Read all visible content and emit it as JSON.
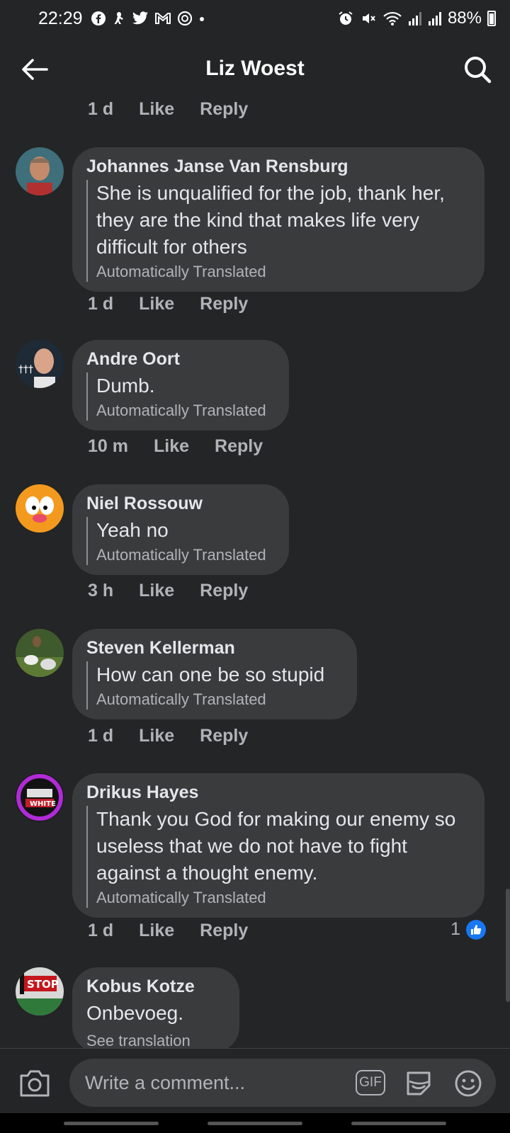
{
  "status_bar": {
    "time": "22:29",
    "left_icons": [
      "facebook-icon",
      "gesture-icon",
      "twitter-icon",
      "gmail-icon",
      "messenger-icon",
      "dot-icon"
    ],
    "right_icons": [
      "alarm-icon",
      "mute-icon",
      "wifi-icon",
      "signal-icon",
      "signal-icon"
    ],
    "battery": "88%"
  },
  "header": {
    "title": "Liz Woest",
    "back_icon": "arrow-left-icon",
    "search_icon": "search-icon"
  },
  "top_meta": {
    "time": "1 d",
    "like": "Like",
    "reply": "Reply"
  },
  "comments": [
    {
      "author": "Johannes Janse Van Rensburg",
      "text": "She is unqualified for the job, thank her, they are the kind that makes life very difficult for others",
      "translated_label": "Automatically Translated",
      "time": "1 d",
      "like": "Like",
      "reply": "Reply"
    },
    {
      "author": "Andre Oort",
      "text": "Dumb.",
      "translated_label": "Automatically Translated",
      "time": "10 m",
      "like": "Like",
      "reply": "Reply"
    },
    {
      "author": "Niel Rossouw",
      "text": "Yeah no",
      "translated_label": "Automatically Translated",
      "time": "3 h",
      "like": "Like",
      "reply": "Reply"
    },
    {
      "author": "Steven Kellerman",
      "text": "How can one be so stupid",
      "translated_label": "Automatically Translated",
      "time": "1 d",
      "like": "Like",
      "reply": "Reply"
    },
    {
      "author": "Drikus Hayes",
      "text": "Thank you God for making our enemy so useless that we do not have to fight against a thought enemy.",
      "translated_label": "Automatically Translated",
      "time": "1 d",
      "like": "Like",
      "reply": "Reply",
      "reaction_count": "1"
    },
    {
      "author": "Kobus Kotze",
      "text": "Onbevoeg.",
      "see_translation": "See translation"
    }
  ],
  "composer": {
    "placeholder": "Write a comment...",
    "gif_label": "GIF",
    "camera_icon": "camera-icon",
    "sticker_icon": "sticker-icon",
    "emoji_icon": "emoji-icon"
  },
  "colors": {
    "background": "#242526",
    "bubble": "#3a3b3c",
    "text_primary": "#e4e6eb",
    "text_secondary": "#b0b3b8",
    "like_blue": "#1877f2"
  }
}
